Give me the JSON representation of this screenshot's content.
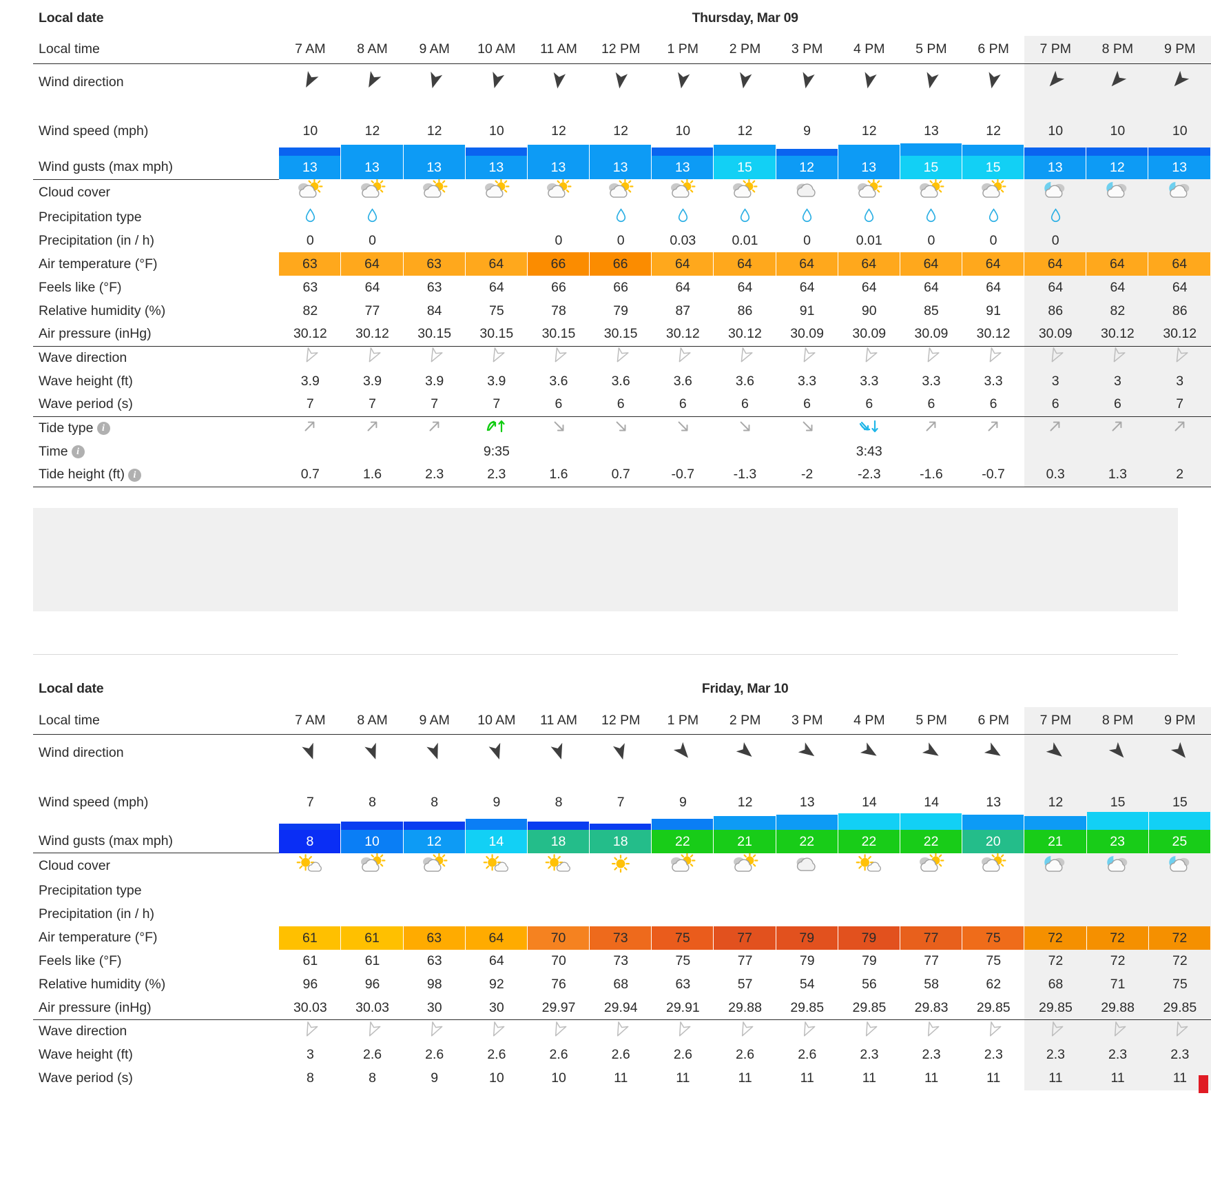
{
  "labels": {
    "local_date": "Local date",
    "local_time": "Local time",
    "wind_direction": "Wind direction",
    "wind_speed": "Wind speed (mph)",
    "wind_gusts": "Wind gusts (max mph)",
    "cloud_cover": "Cloud cover",
    "precip_type": "Precipitation type",
    "precip_amount": "Precipitation (in / h)",
    "air_temperature": "Air temperature (°F)",
    "feels_like": "Feels like (°F)",
    "relative_humidity": "Relative humidity (%)",
    "air_pressure": "Air pressure (inHg)",
    "wave_direction": "Wave direction",
    "wave_height": "Wave height (ft)",
    "wave_period": "Wave period (s)",
    "tide_type": "Tide type",
    "tide_time": "Time",
    "tide_height": "Tide height (ft)",
    "info_icon": "info-icon"
  },
  "hours": [
    "7 AM",
    "8 AM",
    "9 AM",
    "10 AM",
    "11 AM",
    "12 PM",
    "1 PM",
    "2 PM",
    "3 PM",
    "4 PM",
    "5 PM",
    "6 PM",
    "7 PM",
    "8 PM",
    "9 PM"
  ],
  "evening_start_index": 12,
  "colors": {
    "gust_blue_dark": "#0a64f0",
    "gust_blue": "#0d9bf5",
    "gust_cyan": "#12d0f5",
    "gust_teal": "#24bd8a",
    "gust_green": "#18cc18",
    "temp_yellow": "#ffc000",
    "temp_amber": "#ffa500",
    "temp_orange": "#f58220",
    "temp_deep": "#ef6c1a",
    "temp_red": "#e2521e",
    "tide_high": "#12cc12",
    "tide_low": "#1fb6e8",
    "drop": "#28aee4",
    "evening_bg": "#f0f0f0",
    "red_marker": "#e01b24"
  },
  "days": [
    {
      "title": "Thursday, Mar 09",
      "wind_direction": [
        {
          "icon": "wind-arrow",
          "rot": 208
        },
        {
          "icon": "wind-arrow",
          "rot": 208
        },
        {
          "icon": "wind-arrow",
          "rot": 196
        },
        {
          "icon": "wind-arrow",
          "rot": 196
        },
        {
          "icon": "wind-arrow",
          "rot": 188
        },
        {
          "icon": "wind-arrow",
          "rot": 188
        },
        {
          "icon": "wind-arrow",
          "rot": 190
        },
        {
          "icon": "wind-arrow",
          "rot": 190
        },
        {
          "icon": "wind-arrow",
          "rot": 192
        },
        {
          "icon": "wind-arrow",
          "rot": 192
        },
        {
          "icon": "wind-arrow",
          "rot": 192
        },
        {
          "icon": "wind-arrow",
          "rot": 192
        },
        {
          "icon": "wind-arrow",
          "rot": 222
        },
        {
          "icon": "wind-arrow",
          "rot": 222
        },
        {
          "icon": "wind-arrow",
          "rot": 222
        }
      ],
      "wind_speed": [
        "10",
        "12",
        "12",
        "10",
        "12",
        "12",
        "10",
        "12",
        "9",
        "12",
        "13",
        "12",
        "10",
        "10",
        "10"
      ],
      "wind_speed_bar_h": [
        12,
        16,
        16,
        12,
        16,
        16,
        12,
        16,
        10,
        16,
        18,
        16,
        12,
        12,
        12
      ],
      "wind_speed_bar_color": [
        "#0a64f0",
        "#0d9bf5",
        "#0d9bf5",
        "#0a64f0",
        "#0d9bf5",
        "#0d9bf5",
        "#0a64f0",
        "#0d9bf5",
        "#0a64f0",
        "#0d9bf5",
        "#0d9bf5",
        "#0d9bf5",
        "#0a64f0",
        "#0a64f0",
        "#0a64f0"
      ],
      "wind_gusts": [
        "13",
        "13",
        "13",
        "13",
        "13",
        "13",
        "13",
        "15",
        "12",
        "13",
        "15",
        "15",
        "13",
        "12",
        "13"
      ],
      "wind_gusts_color": [
        "#0d9bf5",
        "#0d9bf5",
        "#0d9bf5",
        "#0d9bf5",
        "#0d9bf5",
        "#0d9bf5",
        "#0d9bf5",
        "#12d0f5",
        "#0d9bf5",
        "#0d9bf5",
        "#12d0f5",
        "#12d0f5",
        "#0d9bf5",
        "#0d9bf5",
        "#0d9bf5"
      ],
      "cloud_cover": [
        "partly-cloudy-day",
        "partly-cloudy-day",
        "partly-cloudy-day",
        "partly-cloudy-day",
        "partly-cloudy-day",
        "partly-cloudy-day",
        "partly-cloudy-day",
        "partly-cloudy-day",
        "cloudy",
        "partly-cloudy-day",
        "partly-cloudy-day",
        "partly-cloudy-day",
        "partly-cloudy-night",
        "partly-cloudy-night",
        "partly-cloudy-night"
      ],
      "precip_type": [
        "drop",
        "drop",
        "",
        "",
        "",
        "drop",
        "drop",
        "drop",
        "drop",
        "drop",
        "drop",
        "drop",
        "drop",
        "",
        ""
      ],
      "precip_amount": [
        "0",
        "0",
        "",
        "",
        "0",
        "0",
        "0.03",
        "0.01",
        "0",
        "0.01",
        "0",
        "0",
        "0",
        "",
        ""
      ],
      "air_temperature": [
        "63",
        "64",
        "63",
        "64",
        "66",
        "66",
        "64",
        "64",
        "64",
        "64",
        "64",
        "64",
        "64",
        "64",
        "64"
      ],
      "air_temperature_color": [
        "#ffa81c",
        "#ffa81c",
        "#ffa81c",
        "#ffa81c",
        "#fb8c00",
        "#fb8c00",
        "#ffa81c",
        "#ffa81c",
        "#ffa81c",
        "#ffa81c",
        "#ffa81c",
        "#ffa81c",
        "#ffa81c",
        "#ffa81c",
        "#ffa81c"
      ],
      "feels_like": [
        "63",
        "64",
        "63",
        "64",
        "66",
        "66",
        "64",
        "64",
        "64",
        "64",
        "64",
        "64",
        "64",
        "64",
        "64"
      ],
      "relative_humidity": [
        "82",
        "77",
        "84",
        "75",
        "78",
        "79",
        "87",
        "86",
        "91",
        "90",
        "85",
        "91",
        "86",
        "82",
        "86"
      ],
      "air_pressure": [
        "30.12",
        "30.12",
        "30.15",
        "30.15",
        "30.15",
        "30.15",
        "30.12",
        "30.12",
        "30.09",
        "30.09",
        "30.09",
        "30.12",
        "30.09",
        "30.12",
        "30.12"
      ],
      "wave_direction_rot": [
        208,
        208,
        208,
        208,
        208,
        208,
        208,
        208,
        208,
        208,
        208,
        208,
        208,
        208,
        208
      ],
      "wave_height": [
        "3.9",
        "3.9",
        "3.9",
        "3.9",
        "3.6",
        "3.6",
        "3.6",
        "3.6",
        "3.3",
        "3.3",
        "3.3",
        "3.3",
        "3",
        "3",
        "3"
      ],
      "wave_period": [
        "7",
        "7",
        "7",
        "7",
        "6",
        "6",
        "6",
        "6",
        "6",
        "6",
        "6",
        "6",
        "6",
        "6",
        "7"
      ],
      "tide_type": [
        "rising",
        "rising",
        "rising",
        "high",
        "falling",
        "falling",
        "falling",
        "falling",
        "falling",
        "low",
        "rising",
        "rising",
        "rising",
        "rising",
        "rising"
      ],
      "tide_time": [
        "",
        "",
        "",
        "9:35",
        "",
        "",
        "",
        "",
        "",
        "3:43",
        "",
        "",
        "",
        "",
        ""
      ],
      "tide_height": [
        "0.7",
        "1.6",
        "2.3",
        "2.3",
        "1.6",
        "0.7",
        "-0.7",
        "-1.3",
        "-2",
        "-2.3",
        "-1.6",
        "-0.7",
        "0.3",
        "1.3",
        "2"
      ]
    },
    {
      "title": "Friday, Mar 10",
      "wind_direction": [
        {
          "icon": "wind-arrow",
          "rot": 160
        },
        {
          "icon": "wind-arrow",
          "rot": 160
        },
        {
          "icon": "wind-arrow",
          "rot": 160
        },
        {
          "icon": "wind-arrow",
          "rot": 162
        },
        {
          "icon": "wind-arrow",
          "rot": 162
        },
        {
          "icon": "wind-arrow",
          "rot": 165
        },
        {
          "icon": "wind-arrow",
          "rot": 140
        },
        {
          "icon": "wind-arrow",
          "rot": 130
        },
        {
          "icon": "wind-arrow",
          "rot": 125
        },
        {
          "icon": "wind-arrow",
          "rot": 122
        },
        {
          "icon": "wind-arrow",
          "rot": 122
        },
        {
          "icon": "wind-arrow",
          "rot": 122
        },
        {
          "icon": "wind-arrow",
          "rot": 128
        },
        {
          "icon": "wind-arrow",
          "rot": 138
        },
        {
          "icon": "wind-arrow",
          "rot": 140
        }
      ],
      "wind_speed": [
        "7",
        "8",
        "8",
        "9",
        "8",
        "7",
        "9",
        "12",
        "13",
        "14",
        "14",
        "13",
        "12",
        "15",
        "15"
      ],
      "wind_speed_bar_h": [
        9,
        12,
        12,
        16,
        12,
        9,
        16,
        20,
        22,
        24,
        24,
        22,
        20,
        26,
        26
      ],
      "wind_speed_bar_color": [
        "#0a3df0",
        "#0a3df0",
        "#0a3df0",
        "#0a7ef5",
        "#0a3df0",
        "#0a3df0",
        "#0a7ef5",
        "#0d9bf5",
        "#0d9bf5",
        "#12d0f5",
        "#12d0f5",
        "#0d9bf5",
        "#0d9bf5",
        "#12d0f5",
        "#12d0f5"
      ],
      "wind_gusts": [
        "8",
        "10",
        "12",
        "14",
        "18",
        "18",
        "22",
        "21",
        "22",
        "22",
        "22",
        "20",
        "21",
        "23",
        "25"
      ],
      "wind_gusts_color": [
        "#0a2ef5",
        "#0a7ef5",
        "#0d9bf5",
        "#12d0f5",
        "#24bd8a",
        "#24bd8a",
        "#18cc18",
        "#18cc18",
        "#18cc18",
        "#18cc18",
        "#18cc18",
        "#24bd8a",
        "#18cc18",
        "#18cc18",
        "#18cc18"
      ],
      "cloud_cover": [
        "mostly-sunny",
        "partly-cloudy-day",
        "partly-cloudy-day",
        "mostly-sunny",
        "mostly-sunny",
        "sunny",
        "partly-cloudy-day",
        "partly-cloudy-day",
        "cloudy",
        "mostly-sunny",
        "partly-cloudy-day",
        "partly-cloudy-day",
        "partly-cloudy-night",
        "partly-cloudy-night",
        "partly-cloudy-night"
      ],
      "precip_type": [
        "",
        "",
        "",
        "",
        "",
        "",
        "",
        "",
        "",
        "",
        "",
        "",
        "",
        "",
        ""
      ],
      "precip_amount": [
        "",
        "",
        "",
        "",
        "",
        "",
        "",
        "",
        "",
        "",
        "",
        "",
        "",
        "",
        ""
      ],
      "air_temperature": [
        "61",
        "61",
        "63",
        "64",
        "70",
        "73",
        "75",
        "77",
        "79",
        "79",
        "77",
        "75",
        "72",
        "72",
        "72"
      ],
      "air_temperature_color": [
        "#ffc000",
        "#ffc000",
        "#ffab00",
        "#ffab00",
        "#f58220",
        "#ee6a1c",
        "#ea5c1c",
        "#e2511e",
        "#e2511e",
        "#e2511e",
        "#e8601c",
        "#ef6c1a",
        "#f59000",
        "#f59000",
        "#f59000"
      ],
      "feels_like": [
        "61",
        "61",
        "63",
        "64",
        "70",
        "73",
        "75",
        "77",
        "79",
        "79",
        "77",
        "75",
        "72",
        "72",
        "72"
      ],
      "relative_humidity": [
        "96",
        "96",
        "98",
        "92",
        "76",
        "68",
        "63",
        "57",
        "54",
        "56",
        "58",
        "62",
        "68",
        "71",
        "75"
      ],
      "air_pressure": [
        "30.03",
        "30.03",
        "30",
        "30",
        "29.97",
        "29.94",
        "29.91",
        "29.88",
        "29.85",
        "29.85",
        "29.83",
        "29.85",
        "29.85",
        "29.88",
        "29.85"
      ],
      "wave_direction_rot": [
        206,
        206,
        206,
        206,
        206,
        206,
        206,
        206,
        206,
        206,
        206,
        206,
        206,
        206,
        206
      ],
      "wave_height": [
        "3",
        "2.6",
        "2.6",
        "2.6",
        "2.6",
        "2.6",
        "2.6",
        "2.6",
        "2.6",
        "2.3",
        "2.3",
        "2.3",
        "2.3",
        "2.3",
        "2.3"
      ],
      "wave_period": [
        "8",
        "8",
        "9",
        "10",
        "10",
        "11",
        "11",
        "11",
        "11",
        "11",
        "11",
        "11",
        "11",
        "11",
        "11"
      ],
      "tide_type": [],
      "tide_time": [],
      "tide_height": []
    }
  ]
}
